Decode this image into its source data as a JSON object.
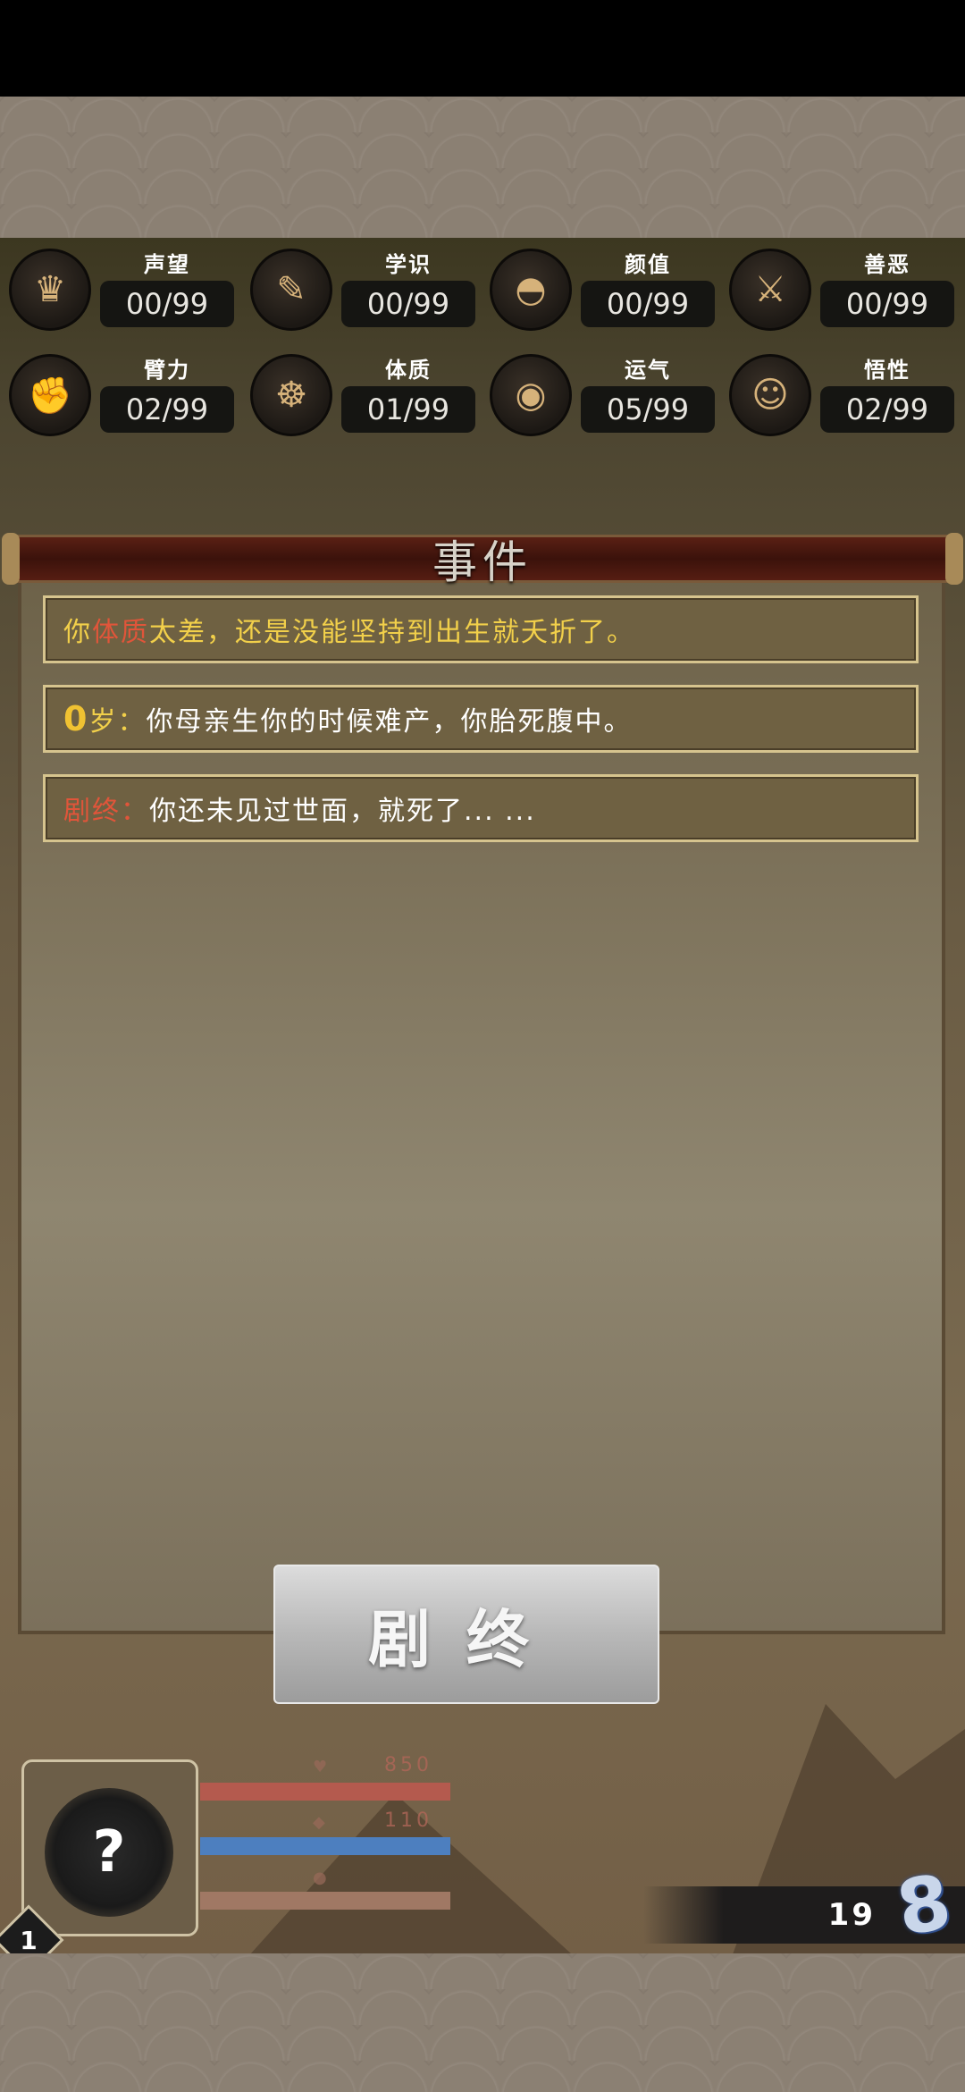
{
  "stats": [
    {
      "label": "声望",
      "value": "00/99",
      "icon": "bell-icon"
    },
    {
      "label": "学识",
      "value": "00/99",
      "icon": "scroll-icon"
    },
    {
      "label": "颜值",
      "value": "00/99",
      "icon": "hat-icon"
    },
    {
      "label": "善恶",
      "value": "00/99",
      "icon": "crossed-swords-icon"
    },
    {
      "label": "臂力",
      "value": "02/99",
      "icon": "arm-icon"
    },
    {
      "label": "体质",
      "value": "01/99",
      "icon": "meditation-icon"
    },
    {
      "label": "运气",
      "value": "05/99",
      "icon": "coin-icon"
    },
    {
      "label": "悟性",
      "value": "02/99",
      "icon": "head-icon"
    }
  ],
  "panel": {
    "title": "事件"
  },
  "events": [
    {
      "parts": [
        {
          "text": "你",
          "style": "yellow"
        },
        {
          "text": "体质",
          "style": "red"
        },
        {
          "text": "太差，还是没能坚持到出生就夭折了。",
          "style": "yellow"
        }
      ]
    },
    {
      "parts": [
        {
          "text": "0",
          "style": "big"
        },
        {
          "text": "岁：",
          "style": "yellow"
        },
        {
          "text": "你母亲生你的时候难产，你胎死腹中。",
          "style": "white"
        }
      ]
    },
    {
      "parts": [
        {
          "text": "剧终：",
          "style": "red"
        },
        {
          "text": "你还未见过世面，就死了... ...",
          "style": "white"
        }
      ]
    }
  ],
  "end_button": {
    "label": "剧终"
  },
  "hud": {
    "avatar_symbol": "?",
    "level": "1",
    "hp_label": "850",
    "mp_label": "110",
    "coins": "19",
    "infinity_symbol": "8"
  },
  "colors": {
    "accent_red": "#e0553a",
    "accent_yellow": "#f2d04a",
    "panel_border": "#d6c48e"
  }
}
